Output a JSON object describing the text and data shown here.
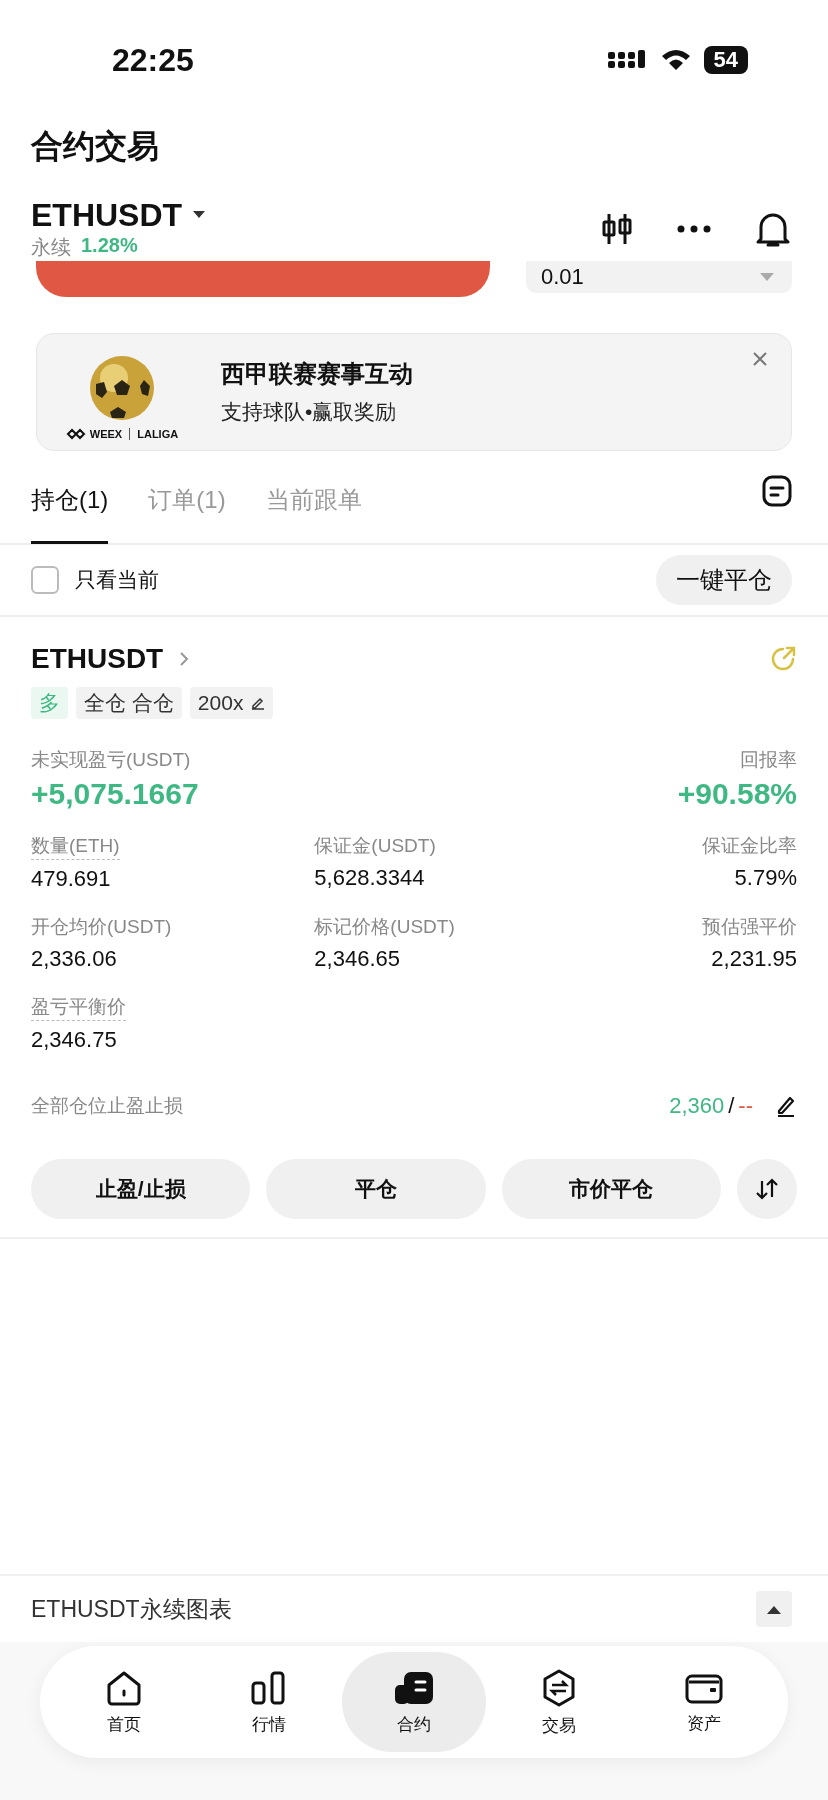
{
  "status_bar": {
    "time": "22:25",
    "battery": "54"
  },
  "header": {
    "title": "合约交易",
    "symbol": "ETHUSDT",
    "contract_type": "永续",
    "change": "1.28%"
  },
  "order_strip": {
    "quantity": "0.01"
  },
  "banner": {
    "logo_brand": "WEEX",
    "logo_partner": "LALIGA",
    "title": "西甲联赛赛事互动",
    "subtitle": "支持球队•赢取奖励"
  },
  "tabs": [
    {
      "label": "持仓(1)",
      "selected": true
    },
    {
      "label": "订单(1)",
      "selected": false
    },
    {
      "label": "当前跟单",
      "selected": false
    }
  ],
  "filter": {
    "label": "只看当前",
    "checked": false,
    "close_all_button": "一键平仓"
  },
  "position": {
    "symbol": "ETHUSDT",
    "tags": [
      {
        "kind": "side",
        "label": "多"
      },
      {
        "kind": "mode",
        "label": "全仓 合仓"
      },
      {
        "kind": "leverage",
        "label": "200x"
      }
    ],
    "pnl_label": "未实现盈亏(USDT)",
    "pnl": "+5,075.1667",
    "roe_label": "回报率",
    "roe": "+90.58%",
    "fields": [
      {
        "label": "数量(ETH)",
        "value": "479.691",
        "underlined": true
      },
      {
        "label": "保证金(USDT)",
        "value": "5,628.3344",
        "underlined": false
      },
      {
        "label": "保证金比率",
        "value": "5.79%",
        "underlined": false
      },
      {
        "label": "开仓均价(USDT)",
        "value": "2,336.06",
        "underlined": false
      },
      {
        "label": "标记价格(USDT)",
        "value": "2,346.65",
        "underlined": false
      },
      {
        "label": "预估强平价",
        "value": "2,231.95",
        "underlined": false
      },
      {
        "label": "盈亏平衡价",
        "value": "2,346.75",
        "underlined": true
      }
    ],
    "tpsl_label": "全部仓位止盈止损",
    "take_profit": "2,360",
    "separator": "/",
    "stop_loss": "--",
    "actions": [
      "止盈/止损",
      "平仓",
      "市价平仓"
    ]
  },
  "chart_bar": {
    "title": "ETHUSDT永续图表"
  },
  "nav": [
    {
      "label": "首页",
      "kind": "home",
      "selected": false
    },
    {
      "label": "行情",
      "kind": "markets",
      "selected": false
    },
    {
      "label": "合约",
      "kind": "futures",
      "selected": true
    },
    {
      "label": "交易",
      "kind": "trade",
      "selected": false
    },
    {
      "label": "资产",
      "kind": "assets",
      "selected": false
    }
  ]
}
